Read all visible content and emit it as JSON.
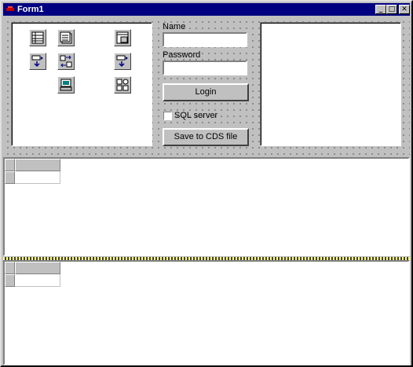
{
  "window": {
    "title": "Form1"
  },
  "title_buttons": {
    "minimize": "_",
    "maximize": "□",
    "close": "✕"
  },
  "components": [
    {
      "icon": "table-icon"
    },
    {
      "icon": "query-icon"
    },
    {
      "icon": "datasource-icon"
    },
    {
      "icon": "provider-icon"
    },
    {
      "icon": "clientdataset-icon"
    },
    {
      "icon": "dataset-provider-icon"
    },
    {
      "icon": "dcom-connection-icon"
    },
    {
      "icon": "socket-connection-icon"
    }
  ],
  "form": {
    "name_label": "Name",
    "name_value": "",
    "password_label": "Password",
    "password_value": "",
    "login_label": "Login",
    "sql_server_label": "SQL server",
    "sql_server_checked": false,
    "save_label": "Save to CDS file"
  },
  "grids": [
    {
      "rows": [
        [
          ""
        ]
      ]
    },
    {
      "rows": [
        [
          ""
        ]
      ]
    }
  ],
  "colors": {
    "title_bar": "#000080",
    "face": "#c0c0c0",
    "splitter": "#ffff80"
  }
}
